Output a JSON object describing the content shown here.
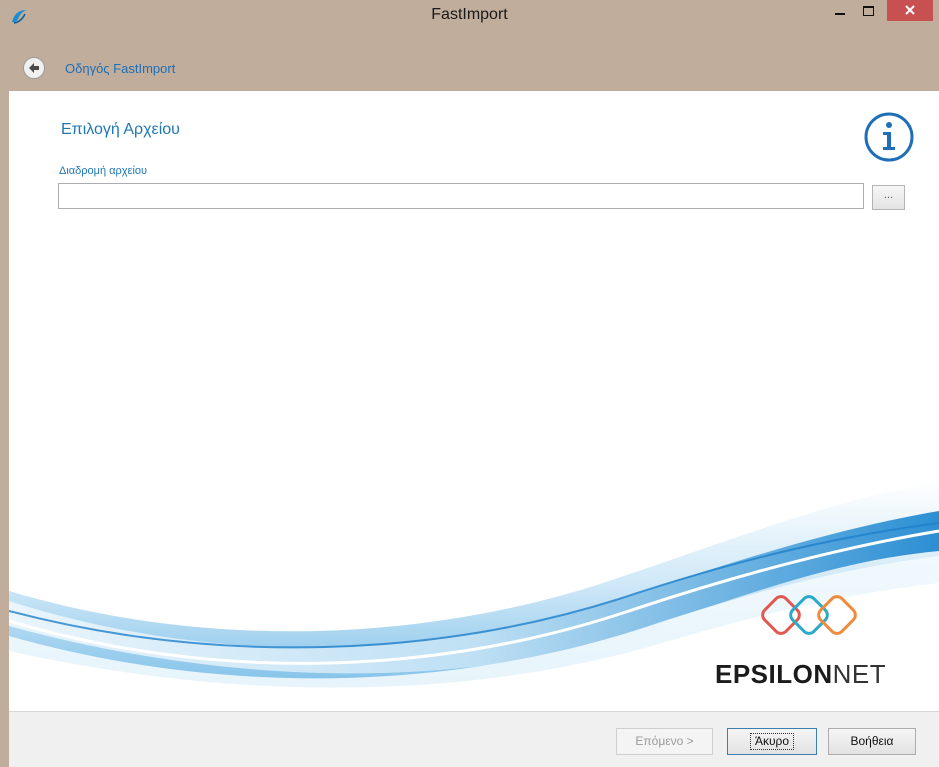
{
  "window": {
    "title": "FastImport"
  },
  "nav": {
    "wizard_title": "Οδηγός FastImport"
  },
  "page": {
    "title": "Επιλογή Αρχείου",
    "path_label": "Διαδρομή αρχείου",
    "path_value": "",
    "browse_label": "..."
  },
  "brand": {
    "name_bold": "EPSILON",
    "name_light": "NET",
    "colors": [
      "#e0584f",
      "#2aa9c9",
      "#f08a3c"
    ]
  },
  "footer": {
    "next_label": "Επόμενο >",
    "cancel_label": "Άκυρο",
    "help_label": "Βοήθεια"
  },
  "colors": {
    "accent": "#2077b6",
    "frame": "#c0ad9c",
    "close": "#c75050"
  }
}
